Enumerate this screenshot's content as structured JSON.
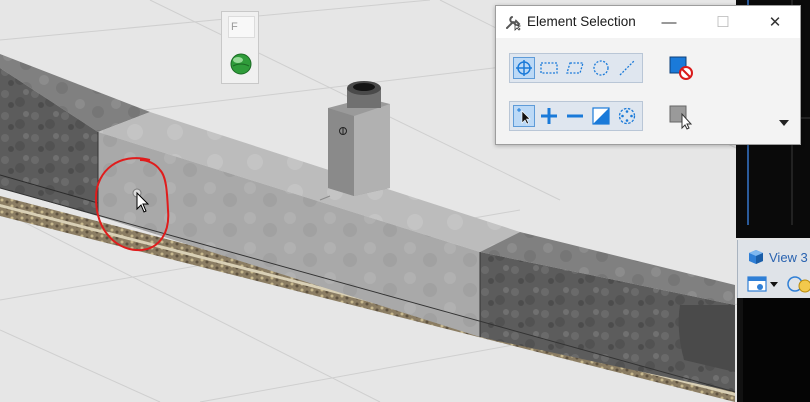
{
  "mini_toolbar": {
    "field_text": "F",
    "globe_icon": "globe-icon"
  },
  "element_selection": {
    "title": "Element Selection",
    "title_icon": "wrench-cursor-icon",
    "window_buttons": {
      "minimize": "—",
      "maximize": "☐",
      "close": "✕"
    },
    "method_tools": [
      "pick-icon",
      "block-icon",
      "shape-icon",
      "circle-icon",
      "line-icon"
    ],
    "mode_tools": [
      "new-selection-icon",
      "add-icon",
      "subtract-icon",
      "invert-icon",
      "clear-icon"
    ],
    "side_tools": [
      "clear-selection-icon",
      "select-all-icon"
    ],
    "dropdown_icon": "chevron-down-icon",
    "colors": {
      "active_bg": "#bcd9f6",
      "accent": "#1a7ad9"
    }
  },
  "view_panel": {
    "title": "View 3"
  }
}
